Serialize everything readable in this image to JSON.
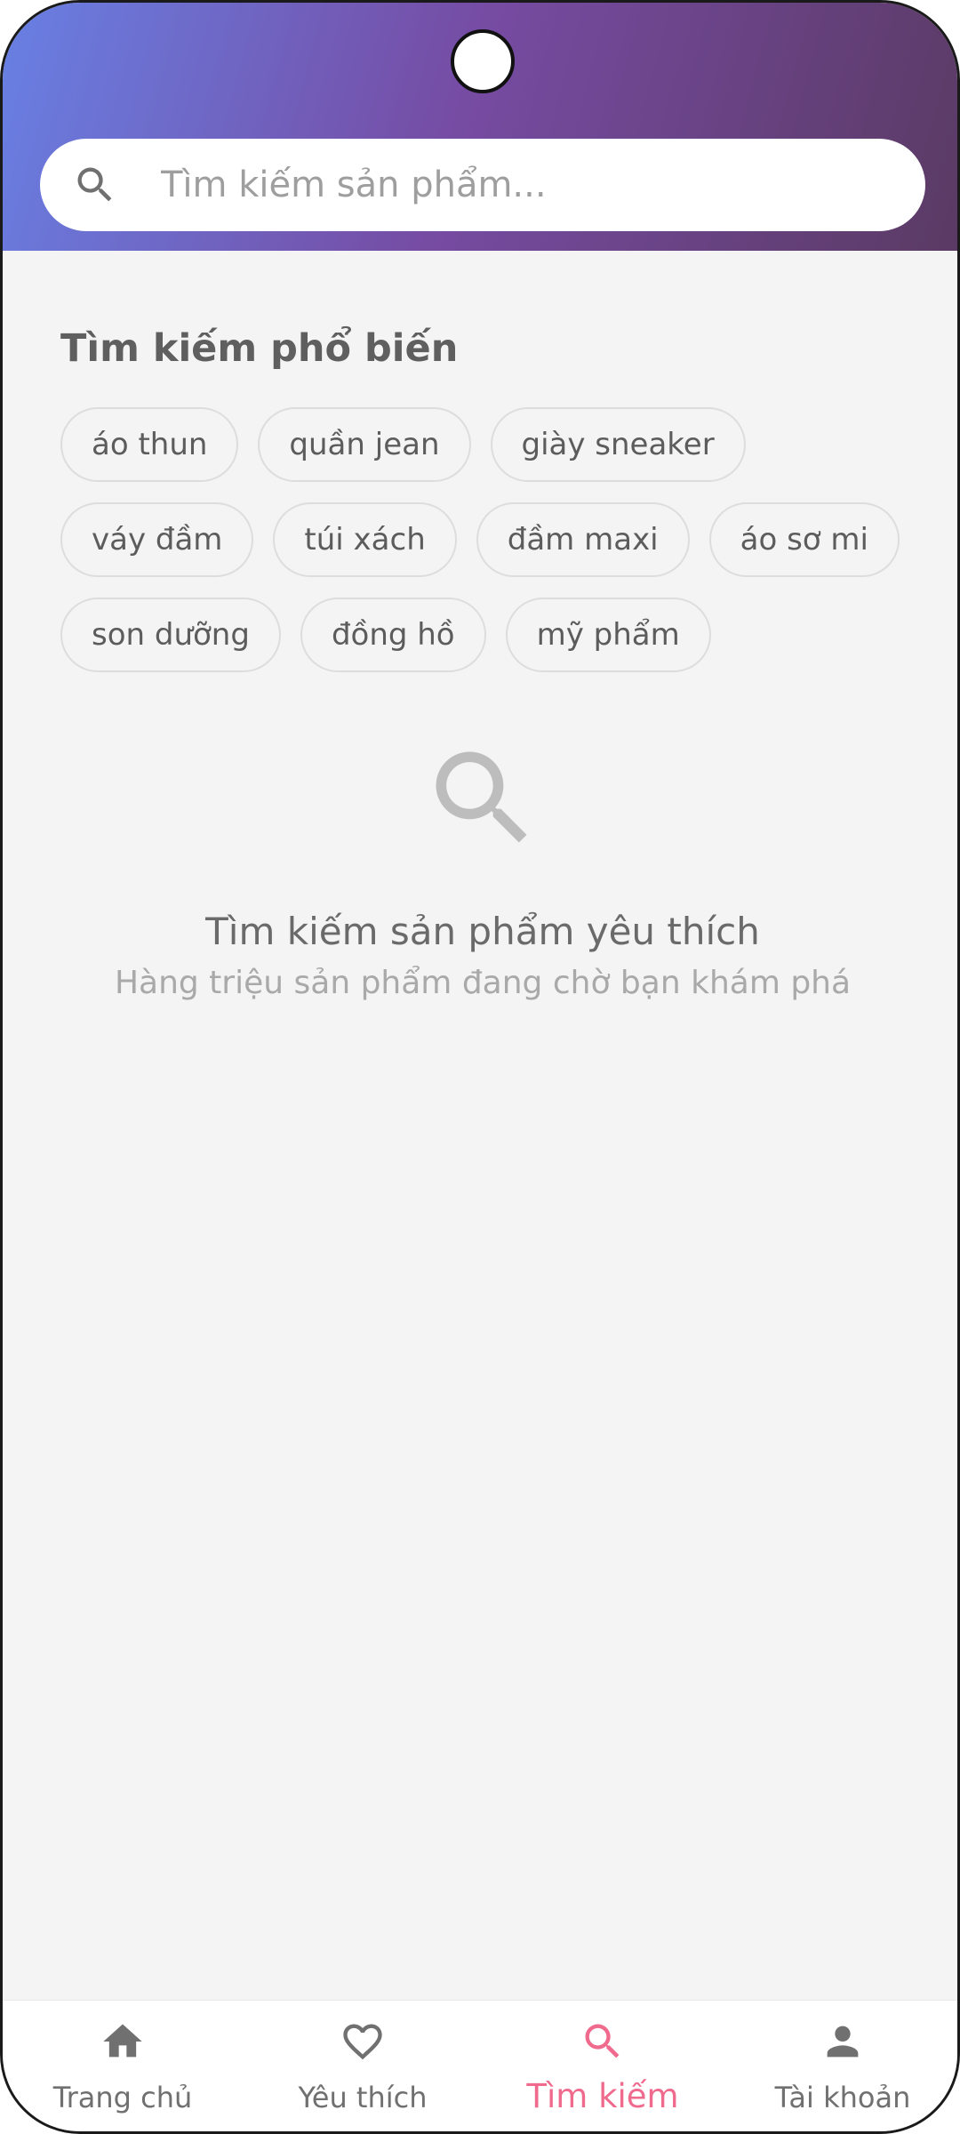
{
  "search": {
    "placeholder": "Tìm kiếm sản phẩm...",
    "icon": "search-icon"
  },
  "popular": {
    "title": "Tìm kiếm phổ biến",
    "rows": [
      [
        "áo thun",
        "quần jean",
        "giày sneaker"
      ],
      [
        "váy đầm",
        "túi xách",
        "đầm maxi",
        "áo sơ mi"
      ],
      [
        "son dưỡng",
        "đồng hồ",
        "mỹ phẩm"
      ]
    ]
  },
  "empty_state": {
    "icon": "search-icon",
    "title": "Tìm kiếm sản phẩm yêu thích",
    "subtitle": "Hàng triệu sản phẩm đang chờ bạn khám phá"
  },
  "bottom_nav": {
    "items": [
      {
        "label": "Trang chủ",
        "icon": "home-icon",
        "active": false
      },
      {
        "label": "Yêu thích",
        "icon": "heart-icon",
        "active": false
      },
      {
        "label": "Tìm kiếm",
        "icon": "search-icon",
        "active": true
      },
      {
        "label": "Tài khoản",
        "icon": "person-icon",
        "active": false
      }
    ]
  },
  "colors": {
    "header_gradient_start": "#6880e4",
    "header_gradient_mid": "#764ba2",
    "header_gradient_end": "#5a3a63",
    "accent": "#f06a8e",
    "background": "#f4f4f4"
  }
}
